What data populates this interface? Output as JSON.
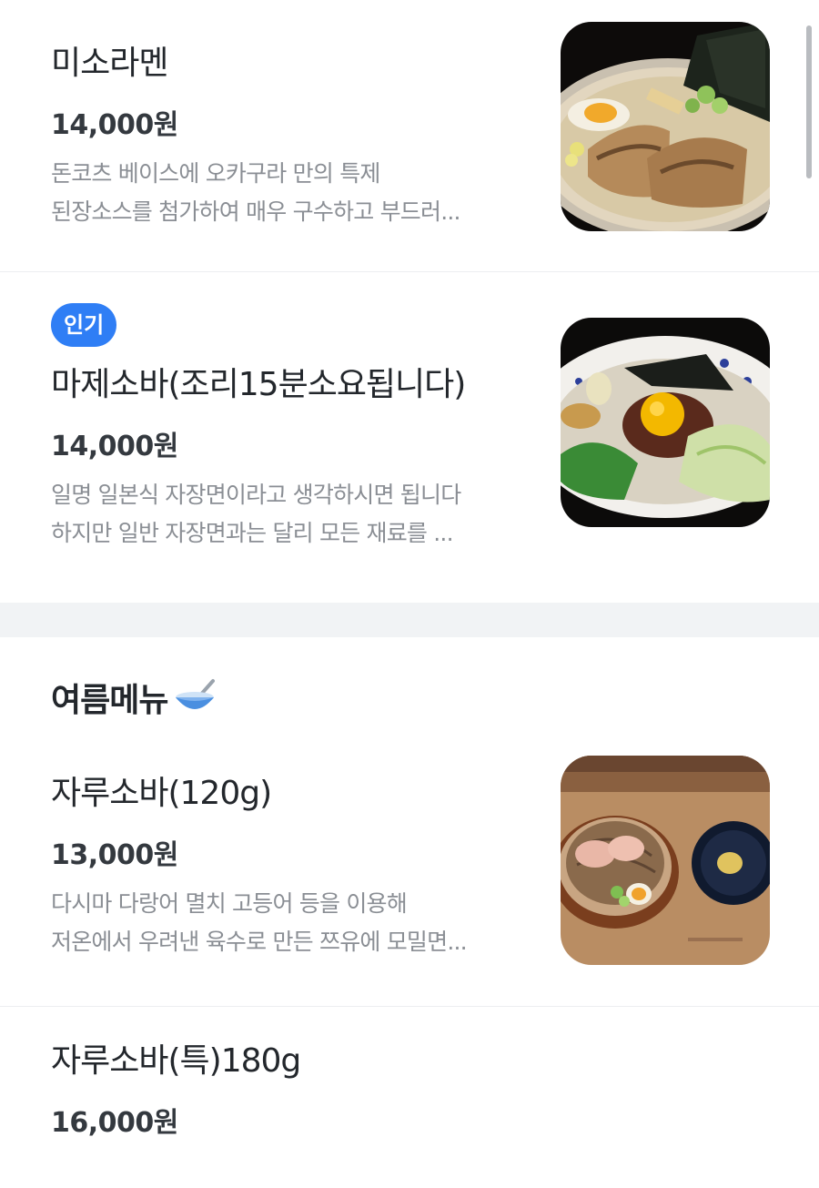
{
  "menu": {
    "items": [
      {
        "name": "미소라멘",
        "price": "14,000원",
        "desc_line1": "돈코츠 베이스에 오카구라 만의 특제",
        "desc_line2": "된장소스를 첨가하여 매우 구수하고 부드러...",
        "image": "miso-ramen-photo"
      },
      {
        "badge": "인기",
        "name": "마제소바(조리15분소요됩니다)",
        "price": "14,000원",
        "desc_line1": "일명 일본식 자장면이라고 생각하시면 됩니다",
        "desc_line2": "하지만 일반 자장면과는 달리 모든 재료를 ...",
        "image": "maze-soba-photo"
      }
    ]
  },
  "summer": {
    "title": "여름메뉴",
    "title_icon": "bowl-with-spoon-icon",
    "items": [
      {
        "name": "자루소바(120g)",
        "price": "13,000원",
        "desc_line1": "다시마 다랑어 멸치 고등어 등을 이용해",
        "desc_line2": "저온에서 우려낸 육수로 만든 쯔유에 모밀면...",
        "image": "zaru-soba-photo"
      },
      {
        "name": "자루소바(특)180g",
        "price": "16,000원"
      }
    ]
  },
  "colors": {
    "badge": "#2f7ef5",
    "section_gap": "#f1f3f5",
    "desc_text": "#8a8e94"
  }
}
